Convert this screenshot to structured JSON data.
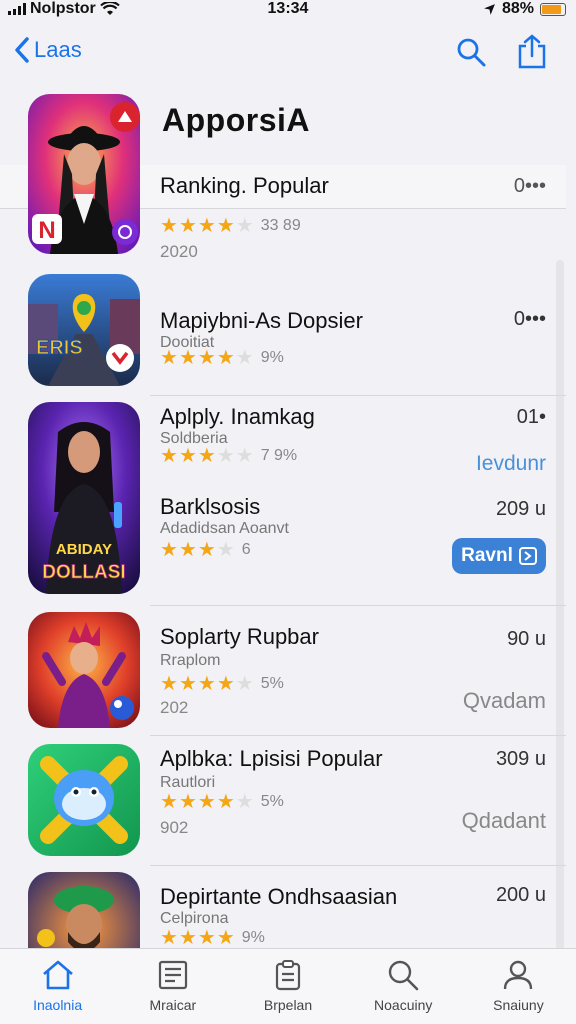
{
  "status_bar": {
    "carrier": "Nolpstor",
    "time": "13:34",
    "battery": "88%",
    "battery_level": 0.88
  },
  "nav": {
    "back_label": "Laas"
  },
  "page_title": "ApporsiA",
  "ranking": {
    "label": "Ranking. Popular",
    "right": "0•••"
  },
  "apps": [
    {
      "rating_count": "33 89",
      "year": "2020",
      "stars": 4
    },
    {
      "title": "Mapiybni-As Dopsier",
      "sub": "Dooitiat",
      "rating_count": "9%",
      "right": "0•••",
      "stars": 4
    },
    {
      "title": "Aplply. Inamkag",
      "sub": "Soldberia",
      "rating_count": "7 9%",
      "right": "01•",
      "right2": "Ievdunr",
      "stars": 3
    },
    {
      "title": "Barklsosis",
      "sub": "Adadidsan Aoanvt",
      "rating_count": "6",
      "right": "209 u",
      "button": "Ravnl",
      "stars": 3
    },
    {
      "title": "Soplarty Rupbar",
      "sub": "Rraplom",
      "rating_count": "5%",
      "year": "202",
      "right": "90 u",
      "right2": "Qvadam",
      "stars": 4
    },
    {
      "title": "Aplbka: Lpisisi Popular",
      "sub": "Rautlori",
      "rating_count": "5%",
      "year": "902",
      "right": "309 u",
      "right2": "Qdadant",
      "stars": 4
    },
    {
      "title": "Depirtante Ondhsaasian",
      "sub": "Celpirona",
      "rating_count": "9%",
      "right": "200 u",
      "stars": 4
    }
  ],
  "icon_text": {
    "poster": "ABIDAY\nDOLLASI",
    "road": "ERIS"
  },
  "tabs": [
    {
      "label": "Inaolnia",
      "icon": "home-icon"
    },
    {
      "label": "Mraicar",
      "icon": "newspaper-icon"
    },
    {
      "label": "Brpelan",
      "icon": "clipboard-icon"
    },
    {
      "label": "Noacuiny",
      "icon": "search-icon"
    },
    {
      "label": "Snaiuny",
      "icon": "person-icon"
    }
  ],
  "colors": {
    "accent": "#1a73e8",
    "star": "#f4a615",
    "button": "#3b82d6"
  }
}
